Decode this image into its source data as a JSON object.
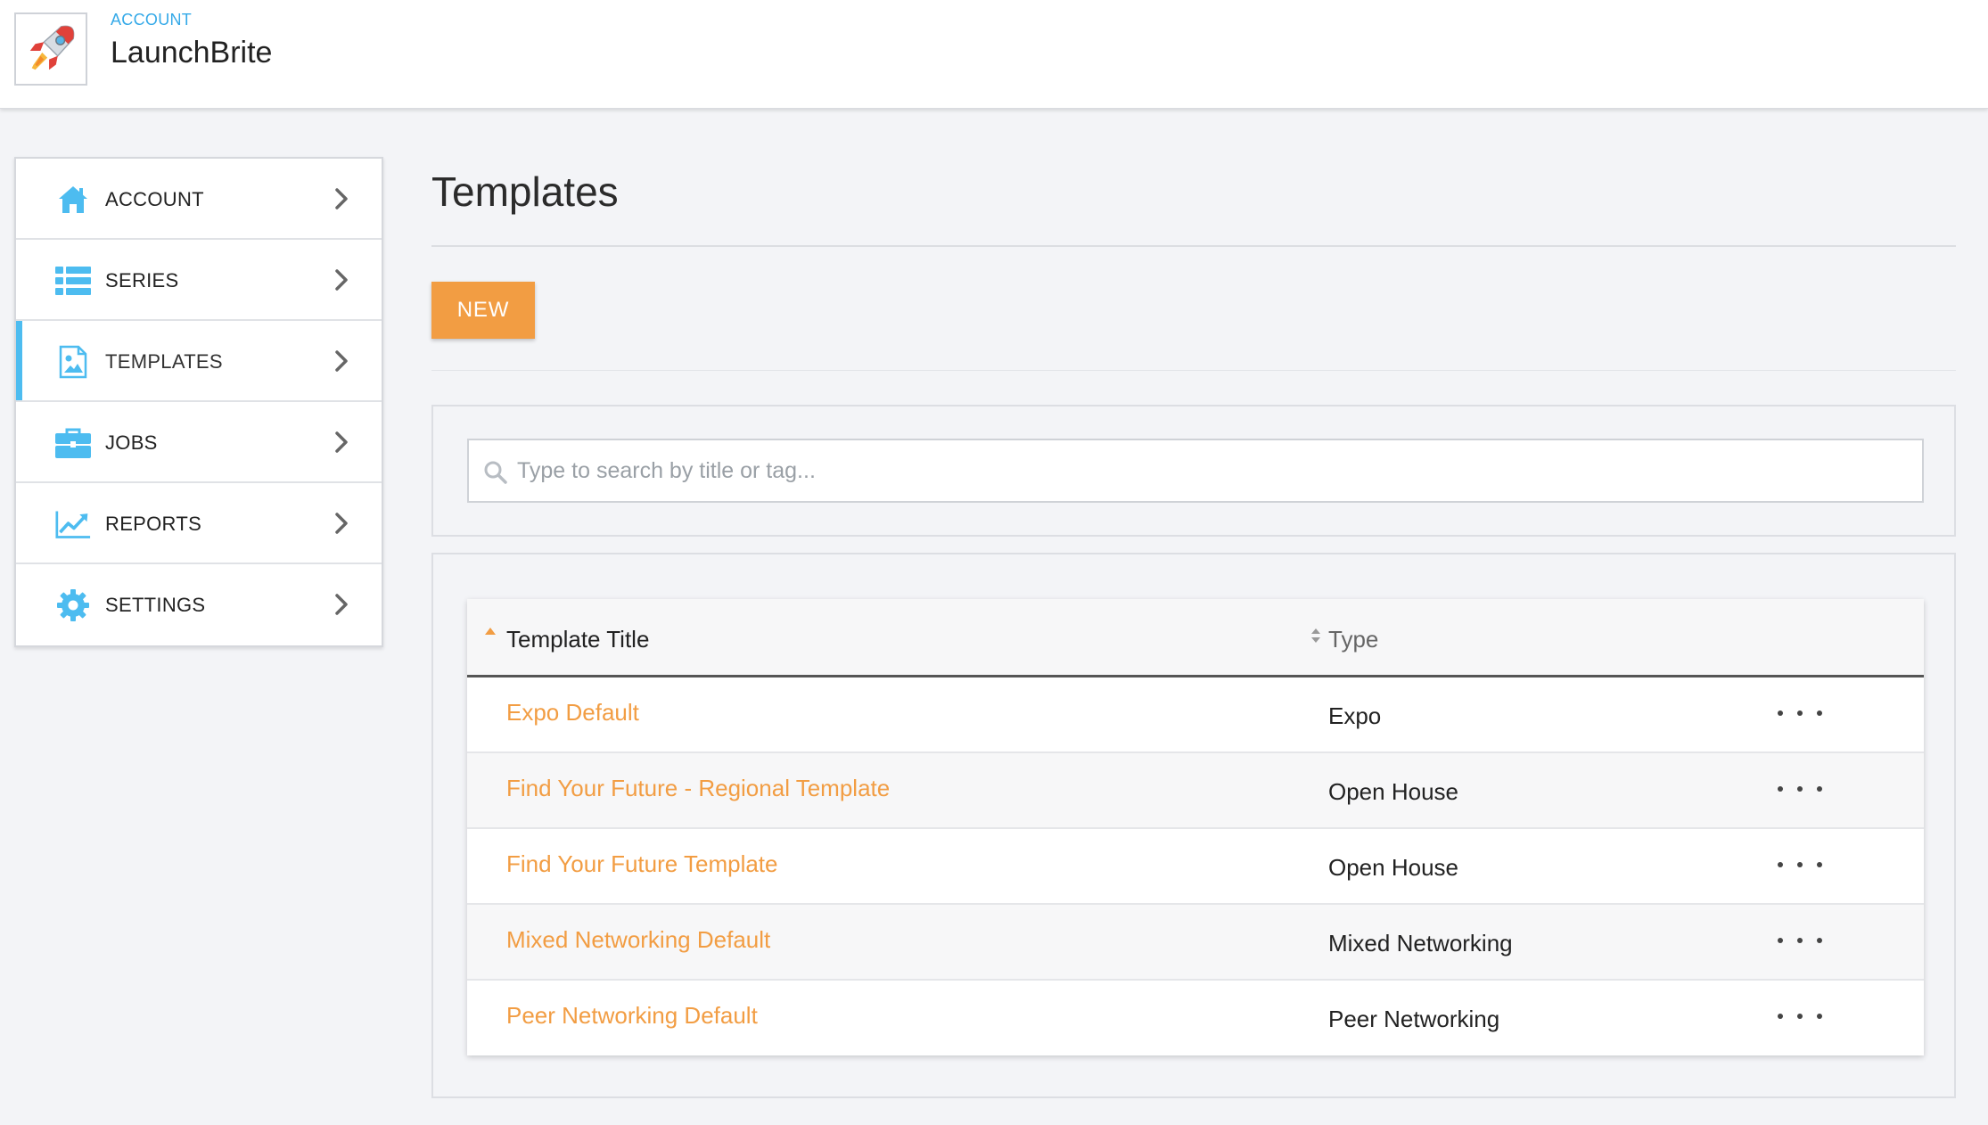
{
  "header": {
    "breadcrumb": "ACCOUNT",
    "title": "LaunchBrite",
    "logo_icon": "rocket-icon"
  },
  "sidebar": {
    "items": [
      {
        "label": "ACCOUNT",
        "icon": "home-icon",
        "active": false
      },
      {
        "label": "SERIES",
        "icon": "list-icon",
        "active": false
      },
      {
        "label": "TEMPLATES",
        "icon": "image-file-icon",
        "active": true
      },
      {
        "label": "JOBS",
        "icon": "briefcase-icon",
        "active": false
      },
      {
        "label": "REPORTS",
        "icon": "trend-chart-icon",
        "active": false
      },
      {
        "label": "SETTINGS",
        "icon": "gear-icon",
        "active": false
      }
    ],
    "accent_color": "#4dbcf0"
  },
  "main": {
    "title": "Templates",
    "new_button": "NEW",
    "search": {
      "placeholder": "Type to search by title or tag...",
      "value": ""
    },
    "table": {
      "columns": [
        "Template Title",
        "Type"
      ],
      "sort": {
        "column": "Template Title",
        "direction": "ascending"
      },
      "rows": [
        {
          "title": "Expo Default",
          "type": "Expo"
        },
        {
          "title": "Find Your Future - Regional Template",
          "type": "Open House"
        },
        {
          "title": "Find Your Future Template",
          "type": "Open House"
        },
        {
          "title": "Mixed Networking Default",
          "type": "Mixed Networking"
        },
        {
          "title": "Peer Networking Default",
          "type": "Peer Networking"
        }
      ],
      "row_actions_icon": "ellipsis-icon"
    }
  },
  "colors": {
    "brand_orange": "#f29d43",
    "link_orange": "#f29d43",
    "accent_blue": "#34a9e8",
    "icon_blue": "#4dbcf0"
  }
}
